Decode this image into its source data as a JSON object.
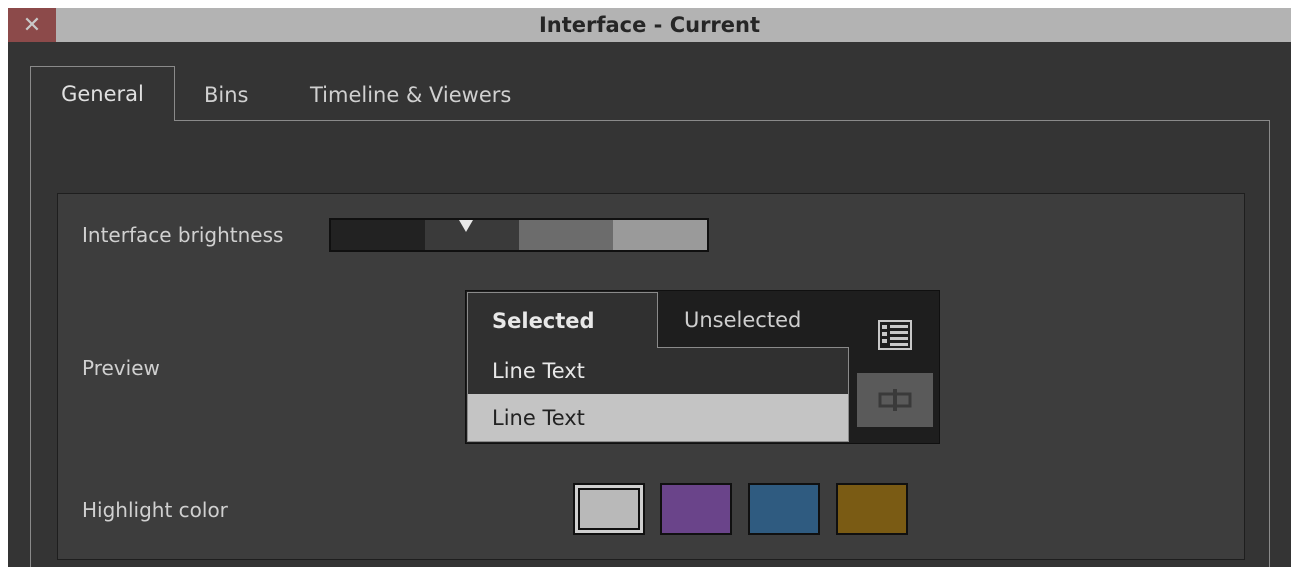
{
  "window": {
    "title": "Interface - Current",
    "close_glyph": "✕"
  },
  "tabs": [
    {
      "label": "General",
      "active": true
    },
    {
      "label": "Bins",
      "active": false
    },
    {
      "label": "Timeline & Viewers",
      "active": false
    }
  ],
  "settings": {
    "brightness_label": "Interface brightness",
    "brightness_levels": [
      "#222222",
      "#3a3a3a",
      "#6c6c6c",
      "#9a9a9a"
    ],
    "brightness_selected_index": 1,
    "preview_label": "Preview",
    "highlight_label": "Highlight color"
  },
  "preview": {
    "tab_selected": "Selected",
    "tab_unselected": "Unselected",
    "line1": "Line Text",
    "line2": "Line Text",
    "icon_list": "list-view-icon",
    "icon_frame": "frame-view-icon"
  },
  "highlight_colors": [
    "#b9b9b9",
    "#6a448a",
    "#2f5b80",
    "#7a5b14"
  ],
  "highlight_selected_index": 0
}
